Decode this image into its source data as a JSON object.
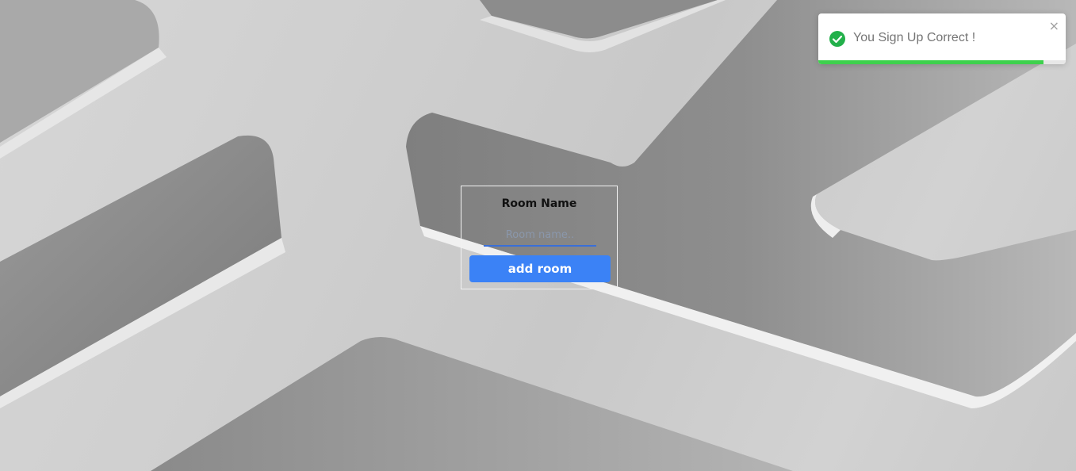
{
  "form": {
    "title": "Room Name",
    "input_placeholder": "Room name..",
    "input_value": "",
    "button_label": "add room",
    "accent_color": "#3b82f6"
  },
  "toast": {
    "message": "You Sign Up Correct !",
    "icon": "check-circle-icon",
    "close_symbol": "×",
    "progress": 0.91,
    "status_color": "#3ed14d"
  }
}
